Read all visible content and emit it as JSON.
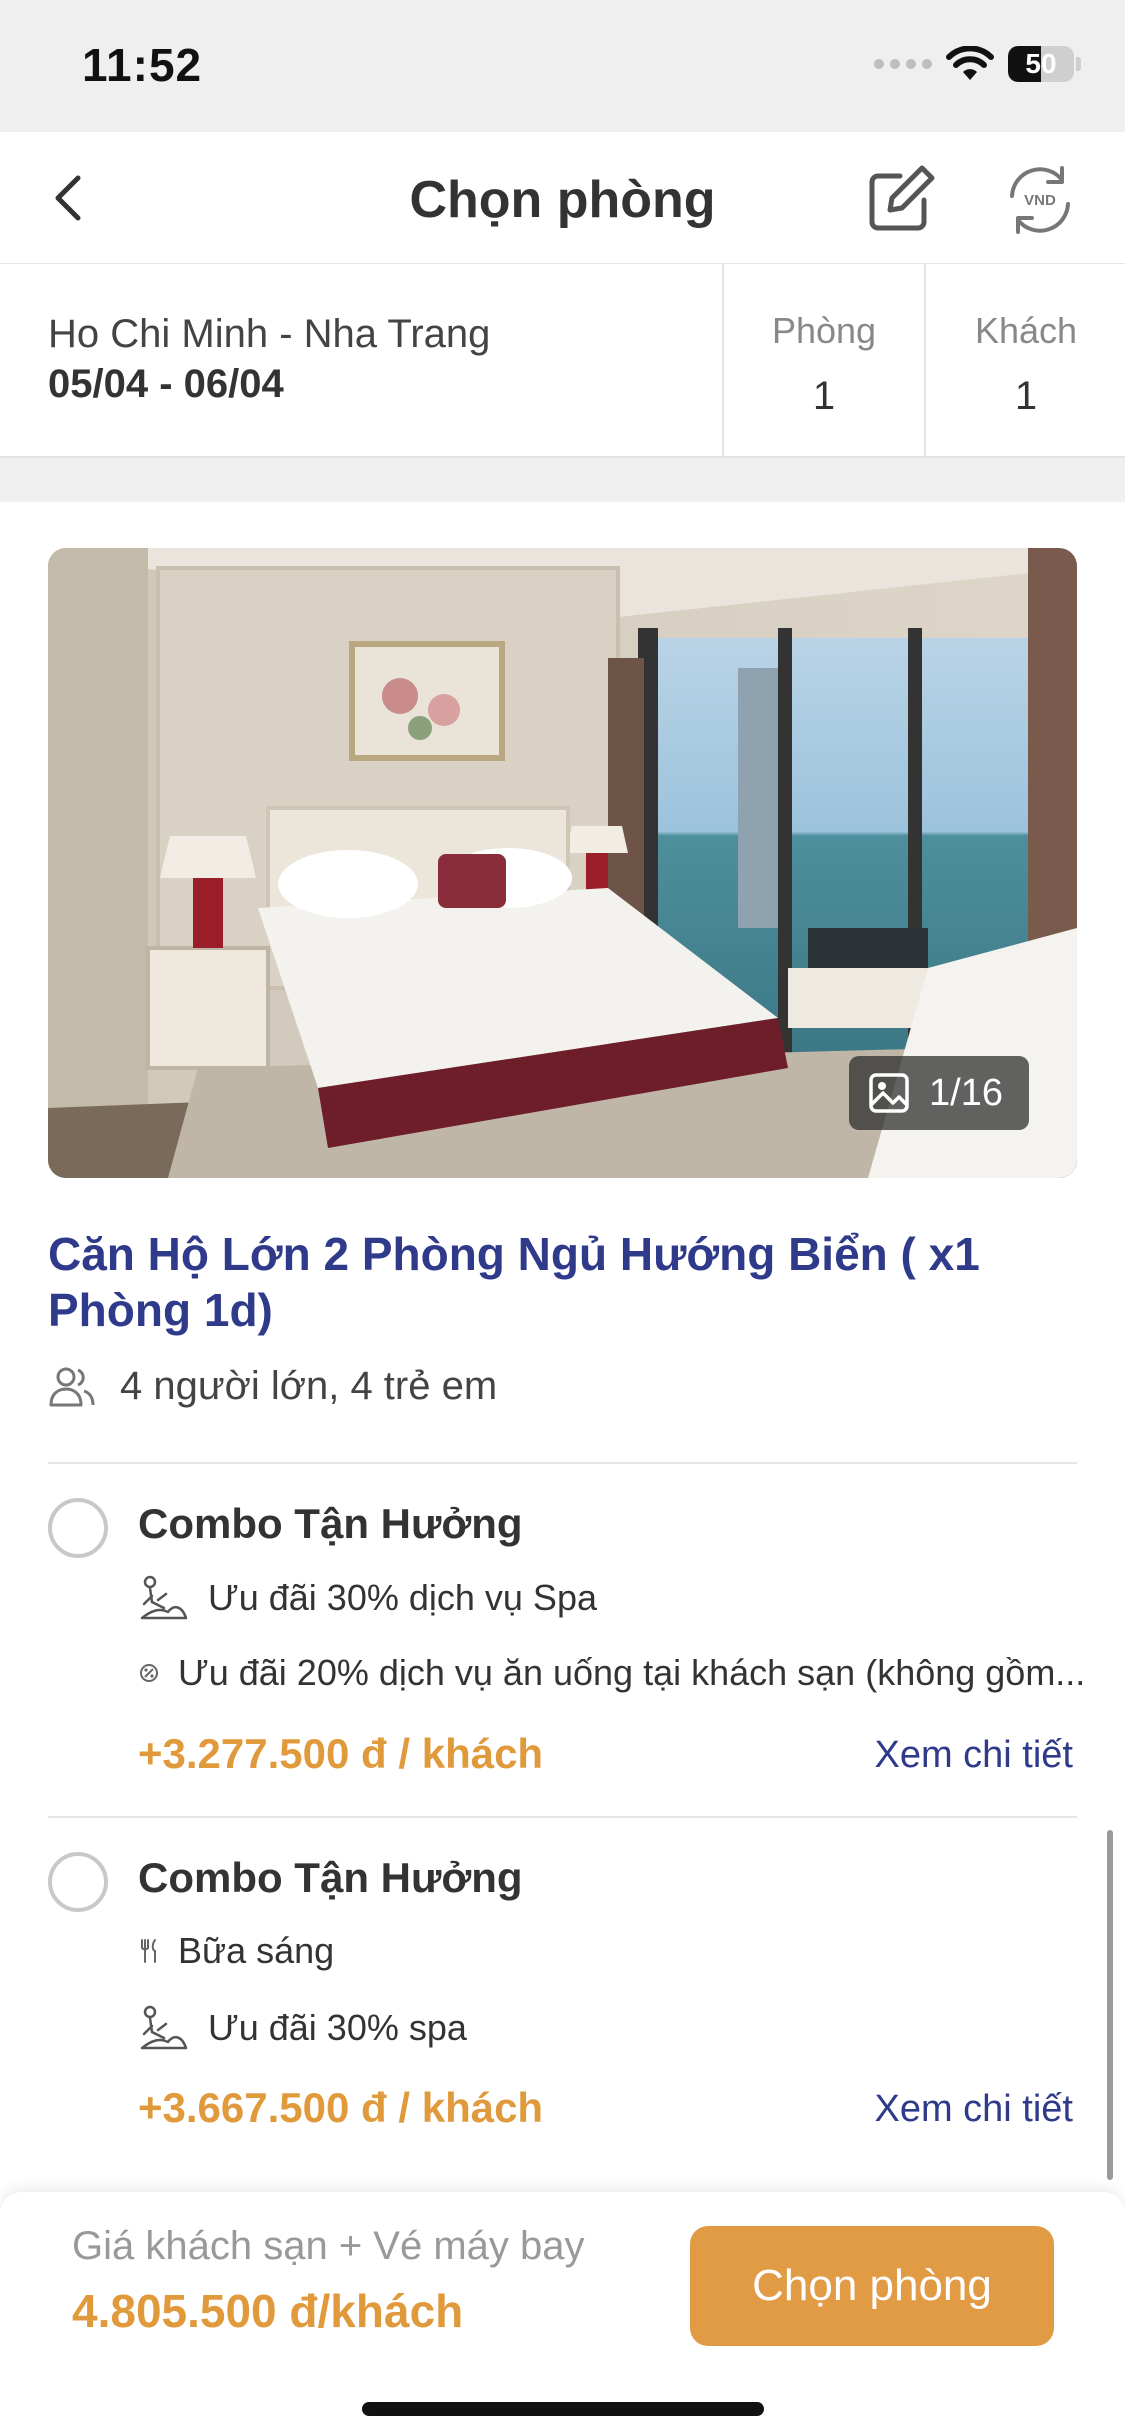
{
  "status_bar": {
    "time": "11:52",
    "battery": "50",
    "battery_level": 0.5
  },
  "nav": {
    "title": "Chọn phòng",
    "currency_icon_text": "VND"
  },
  "trip": {
    "route": "Ho Chi Minh - Nha Trang",
    "dates": "05/04 - 06/04",
    "rooms_label": "Phòng",
    "rooms_value": "1",
    "guests_label": "Khách",
    "guests_value": "1"
  },
  "room": {
    "photo_counter": "1/16",
    "title": "Căn Hộ Lớn 2 Phòng Ngủ Hướng Biển ( x1 Phòng 1d)",
    "capacity": "4 người lớn, 4 trẻ em"
  },
  "combos": [
    {
      "title": "Combo Tận Hưởng",
      "perks": [
        {
          "icon": "spa-icon",
          "text": "Ưu đãi 30% dịch vụ Spa"
        },
        {
          "icon": "dining-discount-icon",
          "text": "Ưu đãi 20% dịch vụ ăn uống tại khách sạn (không gồm..."
        }
      ],
      "price": "+3.277.500 đ / khách",
      "detail_link": "Xem chi tiết"
    },
    {
      "title": "Combo Tận Hưởng",
      "perks": [
        {
          "icon": "cutlery-icon",
          "text": "Bữa sáng"
        },
        {
          "icon": "spa-icon",
          "text": "Ưu đãi 30% spa"
        }
      ],
      "price": "+3.667.500 đ / khách",
      "detail_link": "Xem chi tiết"
    }
  ],
  "bottom": {
    "caption": "Giá khách sạn + Vé máy bay",
    "price": "4.805.500 đ/khách",
    "button_label": "Chọn phòng"
  },
  "colors": {
    "accent": "#e19b45",
    "price": "#e09a3c",
    "link": "#2f3b8a"
  }
}
